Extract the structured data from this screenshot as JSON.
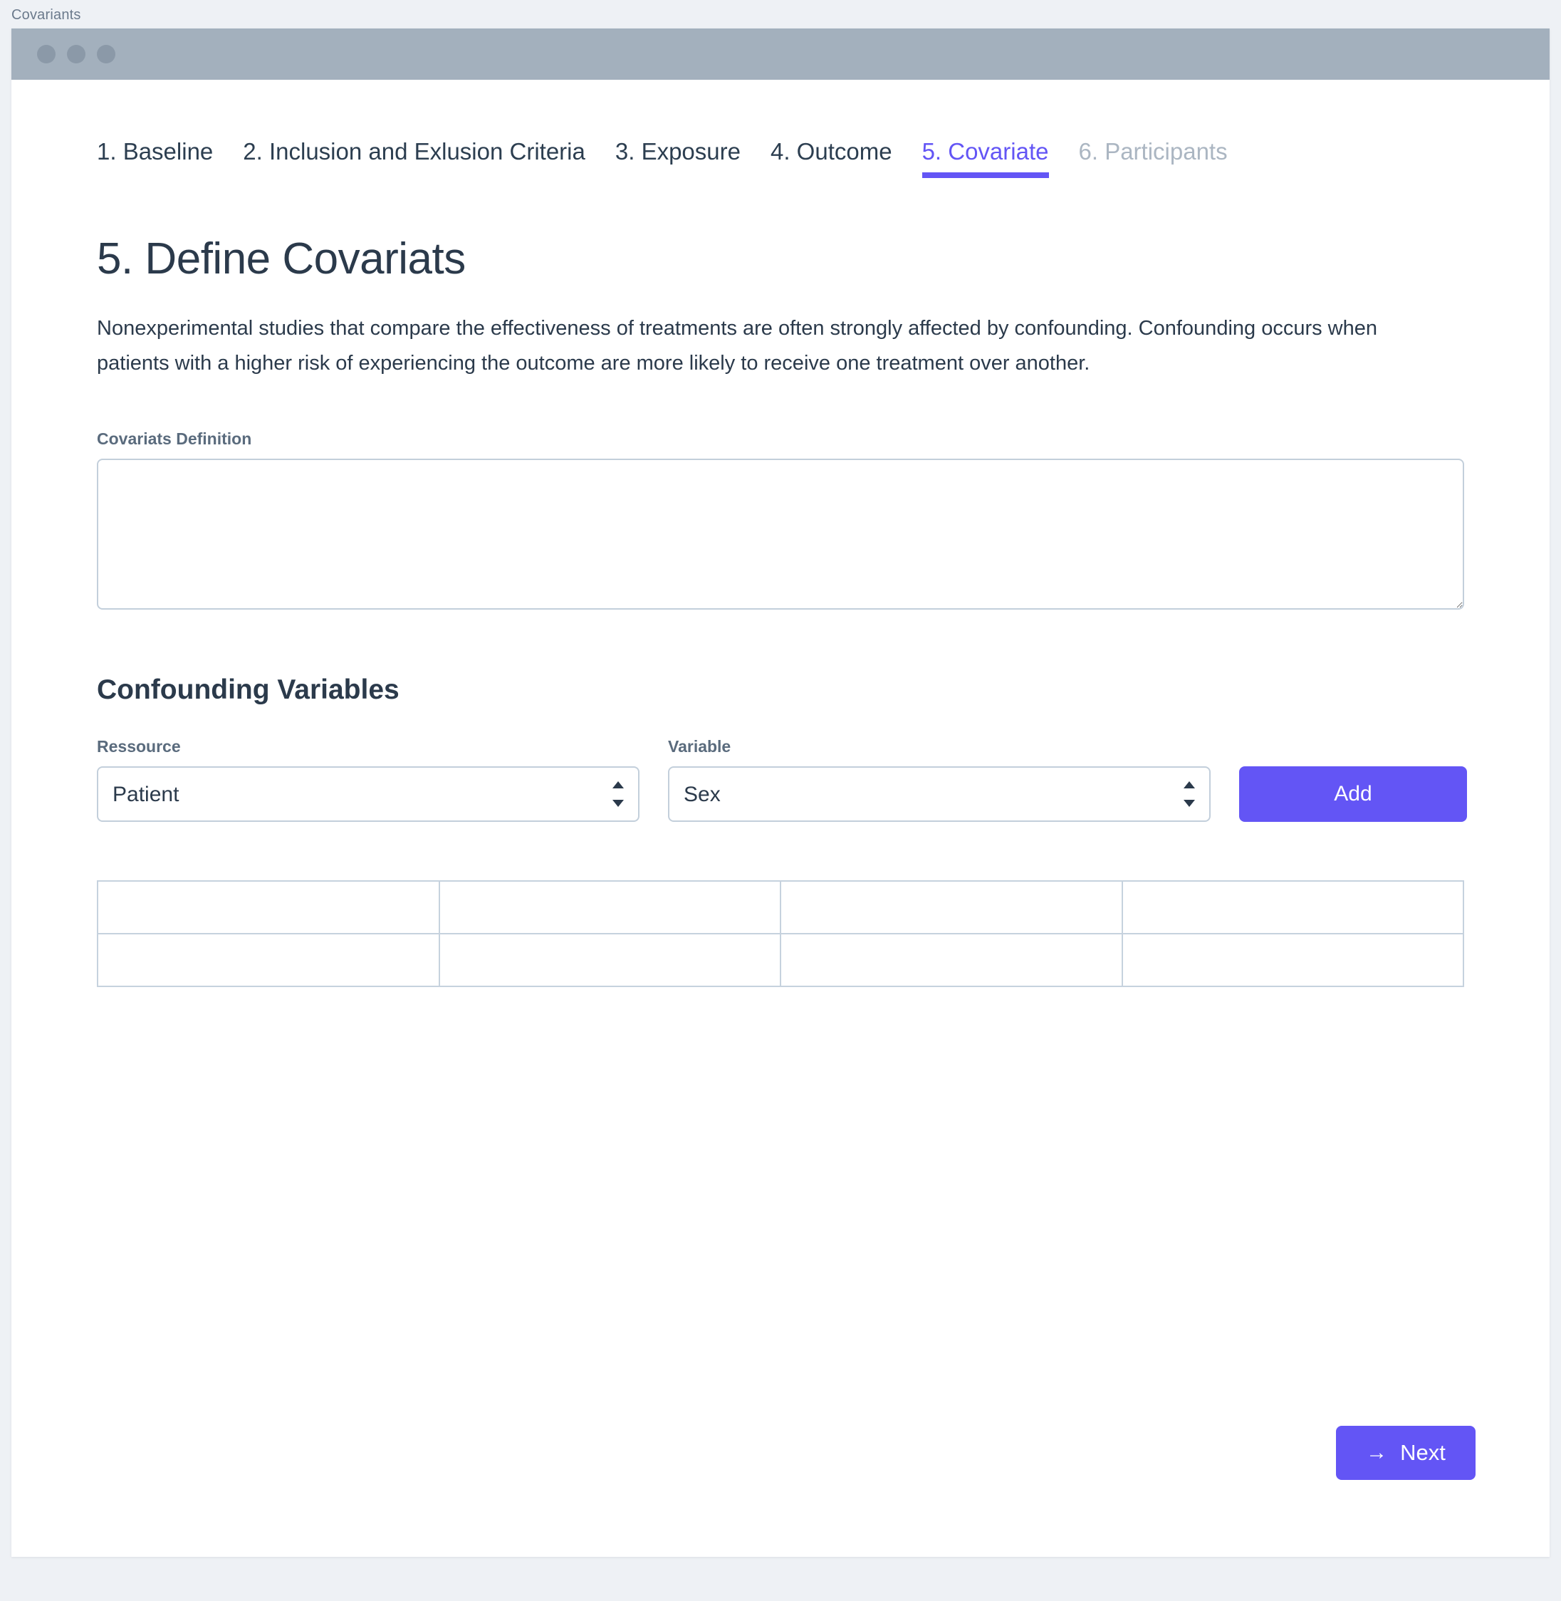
{
  "window": {
    "caption": "Covariants",
    "traffic_lights": [
      "close-dot",
      "minimize-dot",
      "maximize-dot"
    ]
  },
  "tabs": [
    {
      "label": "1. Baseline",
      "state": "normal"
    },
    {
      "label": "2. Inclusion and Exlusion Criteria",
      "state": "normal"
    },
    {
      "label": "3. Exposure",
      "state": "normal"
    },
    {
      "label": "4. Outcome",
      "state": "normal"
    },
    {
      "label": "5. Covariate",
      "state": "active"
    },
    {
      "label": "6. Participants",
      "state": "disabled"
    }
  ],
  "page": {
    "title": "5. Define Covariats",
    "intro": "Nonexperimental studies that compare the effectiveness of treatments are often strongly affected by confounding. Confounding occurs when patients with a higher risk of experiencing the outcome are more likely to receive one treatment over another."
  },
  "definition": {
    "label": "Covariats Definition",
    "value": "",
    "placeholder": ""
  },
  "confounding": {
    "section_title": "Confounding Variables",
    "ressource": {
      "label": "Ressource",
      "selected": "Patient",
      "options": [
        "Patient"
      ]
    },
    "variable": {
      "label": "Variable",
      "selected": "Sex",
      "options": [
        "Sex"
      ]
    },
    "add_label": "Add"
  },
  "table": {
    "columns": [
      "",
      "",
      "",
      ""
    ],
    "rows": [
      [
        "",
        "",
        "",
        ""
      ],
      [
        "",
        "",
        "",
        ""
      ]
    ]
  },
  "footer": {
    "next_label": "Next",
    "next_arrow": "→"
  },
  "colors": {
    "accent": "#6355f5",
    "titlebar": "#a3b0bd",
    "page_background": "#eef1f5",
    "text": "#2b3a4b",
    "muted_text": "#5a6b7d",
    "disabled_text": "#abb6c2",
    "border": "#c3cfdb",
    "table_border": "#c6d2de"
  }
}
